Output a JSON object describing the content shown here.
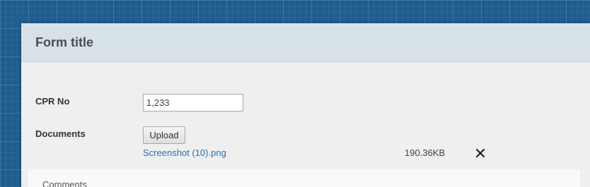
{
  "form": {
    "title": "Form title",
    "cpr_label": "CPR No",
    "cpr_value": "1,233",
    "documents_label": "Documents",
    "upload_label": "Upload",
    "file": {
      "name": "Screenshot (10).png",
      "size": "190.36KB"
    },
    "comments_label": "Comments"
  },
  "colors": {
    "background": "#1f5d8e",
    "header": "#d6e2e8",
    "link": "#2a6ebb"
  },
  "icons": {
    "remove_file": "close-icon"
  }
}
